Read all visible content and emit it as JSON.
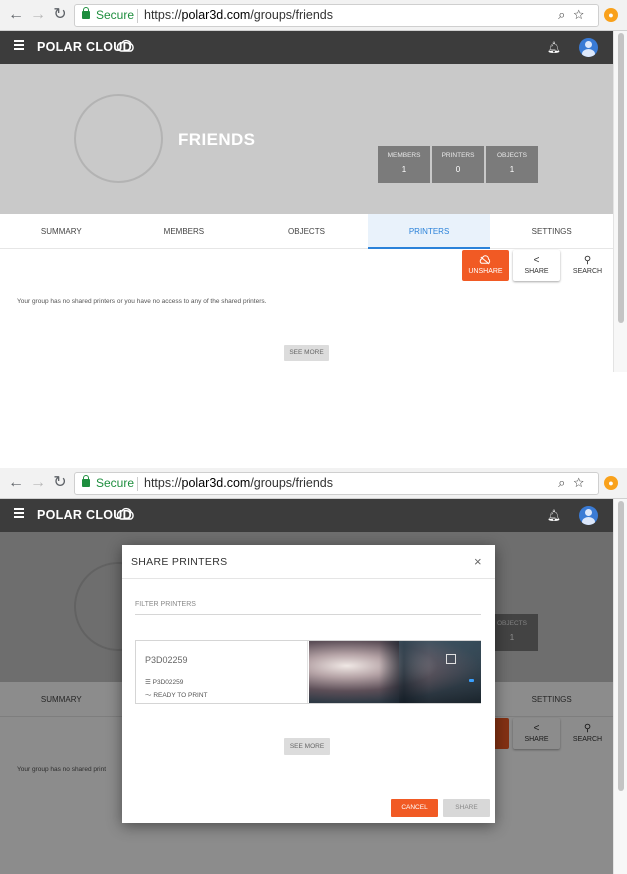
{
  "browser": {
    "secure_label": "Secure",
    "url_prefix": "https://",
    "url_host": "polar3d.com",
    "url_path": "/groups/friends"
  },
  "app": {
    "logo_text": "POLAR CLOUD",
    "brand_color": "#f15a24",
    "accent_color": "#2b82d9"
  },
  "group": {
    "title": "FRIENDS",
    "stats": [
      {
        "label": "MEMBERS",
        "value": "1"
      },
      {
        "label": "PRINTERS",
        "value": "0"
      },
      {
        "label": "OBJECTS",
        "value": "1"
      }
    ]
  },
  "tabs": [
    "SUMMARY",
    "MEMBERS",
    "OBJECTS",
    "PRINTERS",
    "SETTINGS"
  ],
  "active_tab": "PRINTERS",
  "actions": {
    "unshare": "UNSHARE",
    "share": "SHARE",
    "search": "SEARCH"
  },
  "printers_page": {
    "empty_message": "Your group has no shared printers or you have no access to any of the shared printers.",
    "see_more": "SEE MORE"
  },
  "modal": {
    "title": "SHARE PRINTERS",
    "close_glyph": "×",
    "filter_placeholder": "FILTER PRINTERS",
    "printer": {
      "name": "P3D02259",
      "serial": "P3D02259",
      "status": "READY TO PRINT"
    },
    "see_more": "SEE MORE",
    "cancel": "CANCEL",
    "share": "SHARE"
  },
  "shot2_visible": {
    "settings_tab": "SETTINGS",
    "objects_label": "OBJECTS",
    "objects_value": "1",
    "message_start": "Your group has no shared print"
  }
}
